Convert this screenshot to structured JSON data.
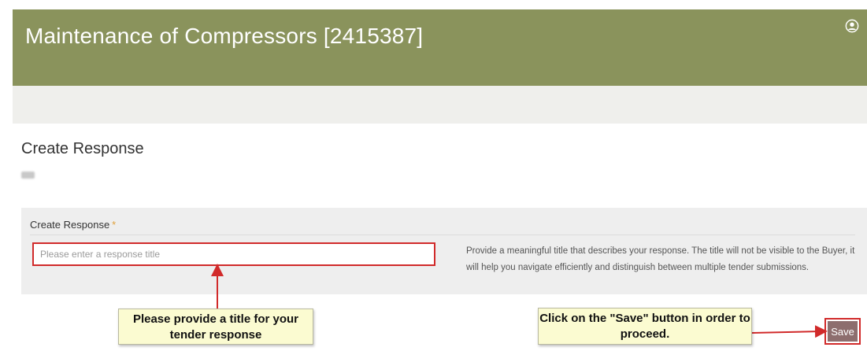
{
  "header": {
    "title": "Maintenance of Compressors [2415387]",
    "user_icon": "user-circle-icon"
  },
  "page": {
    "title": "Create Response"
  },
  "form": {
    "field_label": "Create Response",
    "required_marker": "*",
    "title_input_placeholder": "Please enter a response title",
    "title_input_value": "",
    "help_text": "Provide a meaningful title that describes your response. The title will not be visible to the Buyer, it will help you navigate efficiently and distinguish between multiple tender submissions."
  },
  "callouts": {
    "left": "Please provide a title for your tender response",
    "right": "Click on the \"Save\" button in order to proceed."
  },
  "actions": {
    "save_label": "Save"
  },
  "colors": {
    "header_bg": "#8a935c",
    "highlight_red": "#d12a2a",
    "save_button_bg": "#8d6e6e",
    "callout_bg": "#fbfbd1",
    "required_marker": "#e0a03a"
  }
}
